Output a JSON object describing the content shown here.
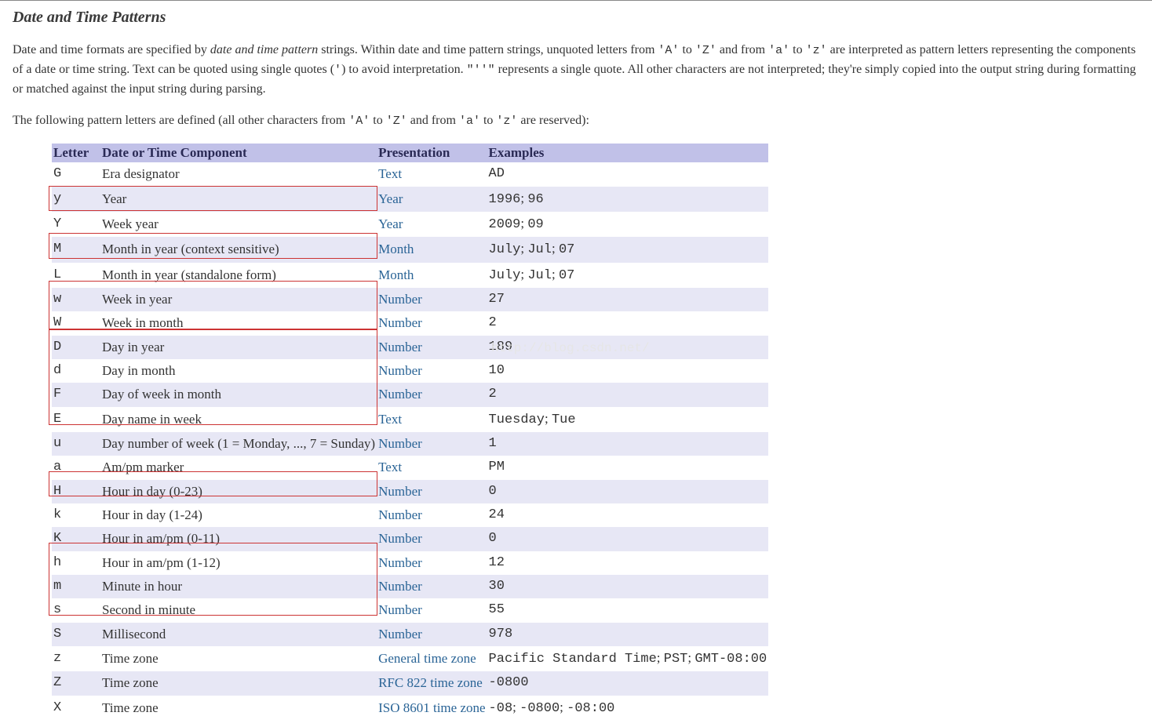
{
  "title": "Date and Time Patterns",
  "intro_parts": {
    "p1_a": "Date and time formats are specified by ",
    "p1_em": "date and time pattern",
    "p1_b": " strings. Within date and time pattern strings, unquoted letters from ",
    "p1_code1": "'A'",
    "p1_c": " to ",
    "p1_code2": "'Z'",
    "p1_d": " and from ",
    "p1_code3": "'a'",
    "p1_e": " to ",
    "p1_code4": "'z'",
    "p1_f": " are interpreted as pattern letters representing the components of a date or time string. Text can be quoted using single quotes (",
    "p1_code5": "'",
    "p1_g": ") to avoid interpretation. ",
    "p1_code6": "\"''\"",
    "p1_h": " represents a single quote. All other characters are not interpreted; they're simply copied into the output string during formatting or matched against the input string during parsing."
  },
  "intro2_parts": {
    "a": "The following pattern letters are defined (all other characters from ",
    "c1": "'A'",
    "b": " to ",
    "c2": "'Z'",
    "c": " and from ",
    "c3": "'a'",
    "d": " to ",
    "c4": "'z'",
    "e": " are reserved):"
  },
  "headers": {
    "letter": "Letter",
    "component": "Date or Time Component",
    "presentation": "Presentation",
    "examples": "Examples"
  },
  "rows": [
    {
      "letter": "G",
      "component": "Era designator",
      "presentation": "Text",
      "examples_code": "AD"
    },
    {
      "letter": "y",
      "component": "Year",
      "presentation": "Year",
      "examples_code": "1996; 96"
    },
    {
      "letter": "Y",
      "component": "Week year",
      "presentation": "Year",
      "examples_code": "2009; 09"
    },
    {
      "letter": "M",
      "component": "Month in year (context sensitive)",
      "presentation": "Month",
      "examples_code": "July; Jul; 07"
    },
    {
      "letter": "L",
      "component": "Month in year (standalone form)",
      "presentation": "Month",
      "examples_code": "July; Jul; 07"
    },
    {
      "letter": "w",
      "component": "Week in year",
      "presentation": "Number",
      "examples_code": "27"
    },
    {
      "letter": "W",
      "component": "Week in month",
      "presentation": "Number",
      "examples_code": "2"
    },
    {
      "letter": "D",
      "component": "Day in year",
      "presentation": "Number",
      "examples_code": "189"
    },
    {
      "letter": "d",
      "component": "Day in month",
      "presentation": "Number",
      "examples_code": "10"
    },
    {
      "letter": "F",
      "component": "Day of week in month",
      "presentation": "Number",
      "examples_code": "2"
    },
    {
      "letter": "E",
      "component": "Day name in week",
      "presentation": "Text",
      "examples_code": "Tuesday; Tue"
    },
    {
      "letter": "u",
      "component": "Day number of week (1 = Monday, ..., 7 = Sunday)",
      "presentation": "Number",
      "examples_code": "1"
    },
    {
      "letter": "a",
      "component": "Am/pm marker",
      "presentation": "Text",
      "examples_code": "PM"
    },
    {
      "letter": "H",
      "component": "Hour in day (0-23)",
      "presentation": "Number",
      "examples_code": "0"
    },
    {
      "letter": "k",
      "component": "Hour in day (1-24)",
      "presentation": "Number",
      "examples_code": "24"
    },
    {
      "letter": "K",
      "component": "Hour in am/pm (0-11)",
      "presentation": "Number",
      "examples_code": "0"
    },
    {
      "letter": "h",
      "component": "Hour in am/pm (1-12)",
      "presentation": "Number",
      "examples_code": "12"
    },
    {
      "letter": "m",
      "component": "Minute in hour",
      "presentation": "Number",
      "examples_code": "30"
    },
    {
      "letter": "s",
      "component": "Second in minute",
      "presentation": "Number",
      "examples_code": "55"
    },
    {
      "letter": "S",
      "component": "Millisecond",
      "presentation": "Number",
      "examples_code": "978"
    },
    {
      "letter": "z",
      "component": "Time zone",
      "presentation": "General time zone",
      "examples_code": "Pacific Standard Time; PST; GMT-08:00"
    },
    {
      "letter": "Z",
      "component": "Time zone",
      "presentation": "RFC 822 time zone",
      "examples_code": "-0800"
    },
    {
      "letter": "X",
      "component": "Time zone",
      "presentation": "ISO 8601 time zone",
      "examples_code": "-08; -0800; -08:00"
    }
  ],
  "watermark": "http://blog.csdn.net/",
  "highlight_groups": [
    {
      "startRow": 1,
      "endRow": 1,
      "colStart": 0,
      "colEnd": 1
    },
    {
      "startRow": 3,
      "endRow": 3,
      "colStart": 0,
      "colEnd": 1
    },
    {
      "startRow": 5,
      "endRow": 6,
      "colStart": 0,
      "colEnd": 1
    },
    {
      "startRow": 7,
      "endRow": 10,
      "colStart": 0,
      "colEnd": 1
    },
    {
      "startRow": 13,
      "endRow": 13,
      "colStart": 0,
      "colEnd": 1
    },
    {
      "startRow": 16,
      "endRow": 18,
      "colStart": 0,
      "colEnd": 1
    }
  ]
}
